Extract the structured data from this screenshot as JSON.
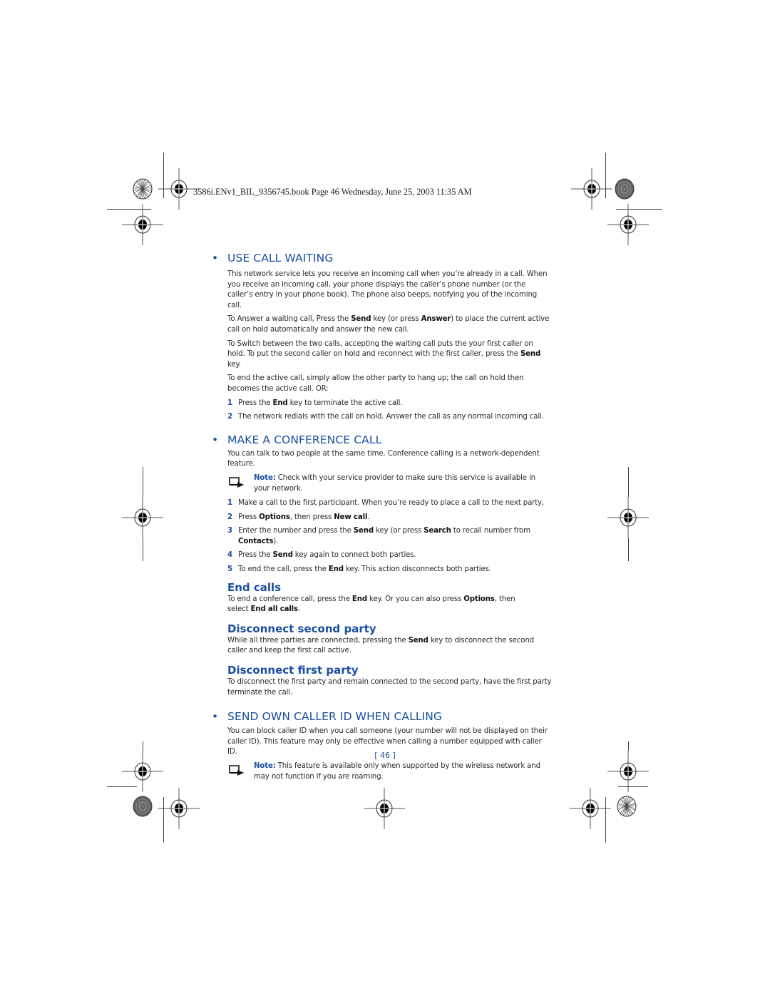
{
  "header": {
    "file_info": "3586i.ENv1_BIL_9356745.book  Page 46  Wednesday, June 25, 2003  11:35 AM"
  },
  "sections": {
    "call_waiting": {
      "title": "USE CALL WAITING",
      "paragraphs": [
        "This network service lets you receive an incoming call when you’re already in a call. When you receive an incoming call, your phone displays the caller’s phone number (or the caller’s entry in your phone book). The phone also beeps, notifying you of the incoming call."
      ],
      "answer": {
        "pre": "To Answer a waiting call, Press the ",
        "b1": "Send",
        "mid": " key (or press ",
        "b2": "Answer",
        "post": ") to place the current active call on hold automatically and answer the new call."
      },
      "switch": {
        "pre": "To Switch between the two calls, accepting the waiting call puts the your first caller on hold. To put the second caller on hold and reconnect with the first caller, press the ",
        "b1": "Send",
        "post": " key."
      },
      "end_active": "To end the active call, simply allow the other party to hang up; the call on hold then becomes the active call. OR:",
      "steps": [
        {
          "num": "1",
          "pre": "Press the ",
          "b1": "End",
          "post": " key to terminate the active call."
        },
        {
          "num": "2",
          "text": "The network redials with the call on hold. Answer the call as any normal incoming call."
        }
      ]
    },
    "conference": {
      "title": "MAKE A CONFERENCE CALL",
      "intro": "You can talk to two people at the same time. Conference calling is a network-dependent feature.",
      "note_label": "Note:",
      "note_text": " Check with your service provider to make sure this service is available in your network.",
      "steps": [
        {
          "num": "1",
          "text": "Make a call to the first participant. When you’re ready to place a call to the next party,"
        },
        {
          "num": "2",
          "pre": "Press ",
          "b1": "Options",
          "mid": ", then press ",
          "b2": "New call",
          "post": "."
        },
        {
          "num": "3",
          "pre": "Enter the number and press the ",
          "b1": "Send",
          "mid": " key (or press ",
          "b2": "Search",
          "mid2": " to recall number from ",
          "b3": "Contacts",
          "post": ")."
        },
        {
          "num": "4",
          "pre": "Press the ",
          "b1": "Send",
          "post": " key again to connect both parties."
        },
        {
          "num": "5",
          "pre": "To end the call, press the ",
          "b1": "End",
          "post": " key. This action disconnects both parties."
        }
      ]
    },
    "end_calls": {
      "title": "End calls",
      "pre": "To end a conference call, press the ",
      "b1": "End",
      "mid": " key. Or you can also press ",
      "b2": "Options",
      "mid2": ", then select ",
      "b3": "End all calls",
      "post": "."
    },
    "disconnect_second": {
      "title": "Disconnect second party",
      "pre": "While all three parties are connected, pressing the ",
      "b1": "Send",
      "post": " key to disconnect the second caller and keep the first call active."
    },
    "disconnect_first": {
      "title": "Disconnect first party",
      "text": "To disconnect the first party and remain connected to the second party, have the first party terminate the call."
    },
    "caller_id": {
      "title": "SEND OWN CALLER ID WHEN CALLING",
      "intro": "You can block caller ID when you call someone (your number will not be displayed on their caller ID). This feature may only be effective when calling a number equipped with caller ID.",
      "note_label": "Note:",
      "note_text": " This feature is available only when supported by the wireless network and may not function if you are roaming."
    }
  },
  "footer": {
    "page_number": "[ 46 ]"
  },
  "colors": {
    "heading": "#1a4ea0",
    "body_text": "#2a2a2a"
  },
  "icons": {
    "section_bullet": "•",
    "note_icon": "note-arrow-icon",
    "registration_mark": "crosshair-registration-icon"
  }
}
